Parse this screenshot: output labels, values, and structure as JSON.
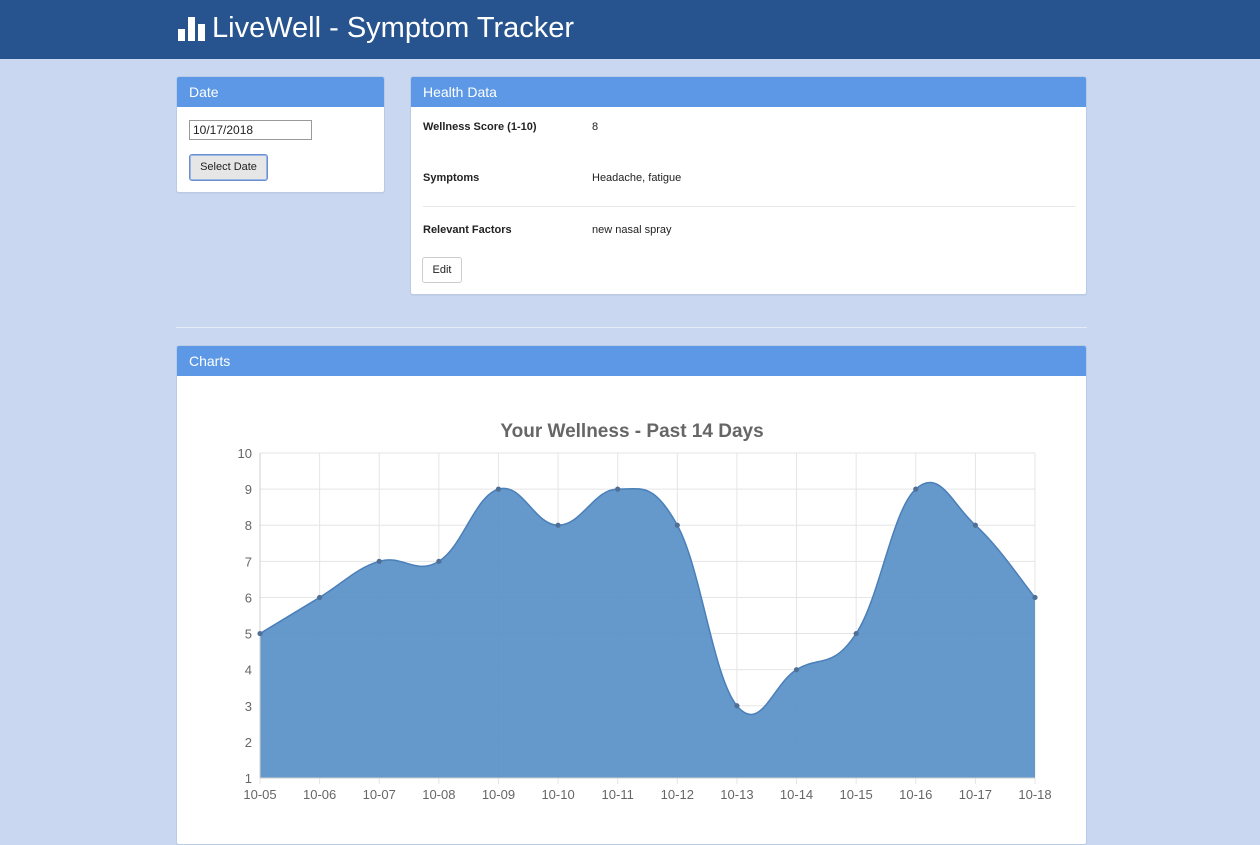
{
  "app": {
    "title": "LiveWell - Symptom Tracker",
    "brand_icon": "bar-chart-icon"
  },
  "date_panel": {
    "heading": "Date",
    "date_value": "10/17/2018",
    "select_button": "Select Date"
  },
  "health_panel": {
    "heading": "Health Data",
    "rows": [
      {
        "label": "Wellness Score (1-10)",
        "value": "8"
      },
      {
        "label": "Symptoms",
        "value": "Headache, fatigue"
      },
      {
        "label": "Relevant Factors",
        "value": "new nasal spray"
      }
    ],
    "edit_button": "Edit"
  },
  "charts_panel": {
    "heading": "Charts"
  },
  "chart_data": {
    "type": "area",
    "title": "Your Wellness - Past 14 Days",
    "xlabel": "",
    "ylabel": "",
    "categories": [
      "10-05",
      "10-06",
      "10-07",
      "10-08",
      "10-09",
      "10-10",
      "10-11",
      "10-12",
      "10-13",
      "10-14",
      "10-15",
      "10-16",
      "10-17",
      "10-18"
    ],
    "values": [
      5,
      6,
      7,
      7,
      9,
      8,
      9,
      8,
      3,
      4,
      5,
      9,
      8,
      6
    ],
    "ylim": [
      1,
      10
    ],
    "yticks": [
      1,
      2,
      3,
      4,
      5,
      6,
      7,
      8,
      9,
      10
    ],
    "grid": true,
    "legend": "none",
    "fill_color": "#5990c7",
    "line_color": "#4a7fb8"
  },
  "colors": {
    "navbar": "#27548e",
    "panel_heading": "#5c98e6",
    "background": "#c9d8f0"
  }
}
